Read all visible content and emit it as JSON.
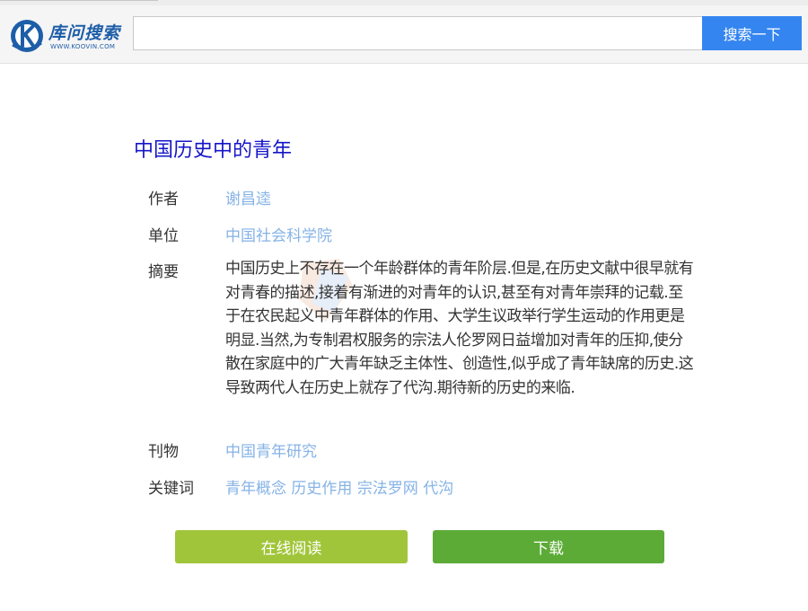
{
  "header": {
    "logo_text": "库问搜索",
    "logo_subtext": "WWW.KOOVIN.COM",
    "search_placeholder": "",
    "search_button_label": "搜索一下"
  },
  "article": {
    "title": "中国历史中的青年",
    "author_label": "作者",
    "author": "谢昌逵",
    "unit_label": "单位",
    "unit": "中国社会科学院",
    "abstract_label": "摘要",
    "abstract": "中国历史上不存在一个年龄群体的青年阶层.但是,在历史文献中很早就有对青春的描述,接着有渐进的对青年的认识,甚至有对青年崇拜的记载.至于在农民起义中青年群体的作用、大学生议政举行学生运动的作用更是明显.当然,为专制君权服务的宗法人伦罗网日益增加对青年的压抑,使分散在家庭中的广大青年缺乏主体性、创造性,似乎成了青年缺席的历史.这导致两代人在历史上就存了代沟.期待新的历史的来临.",
    "journal_label": "刊物",
    "journal": "中国青年研究",
    "keywords_label": "关键词",
    "keywords": [
      "青年概念",
      "历史作用",
      "宗法罗网",
      "代沟"
    ]
  },
  "actions": {
    "read_online_label": "在线阅读",
    "download_label": "下载"
  },
  "colors": {
    "search_button": "#3485f0",
    "title": "#1515c8",
    "link": "#86b3e6",
    "read_button": "#a1c53a",
    "download_button": "#5cab36"
  }
}
